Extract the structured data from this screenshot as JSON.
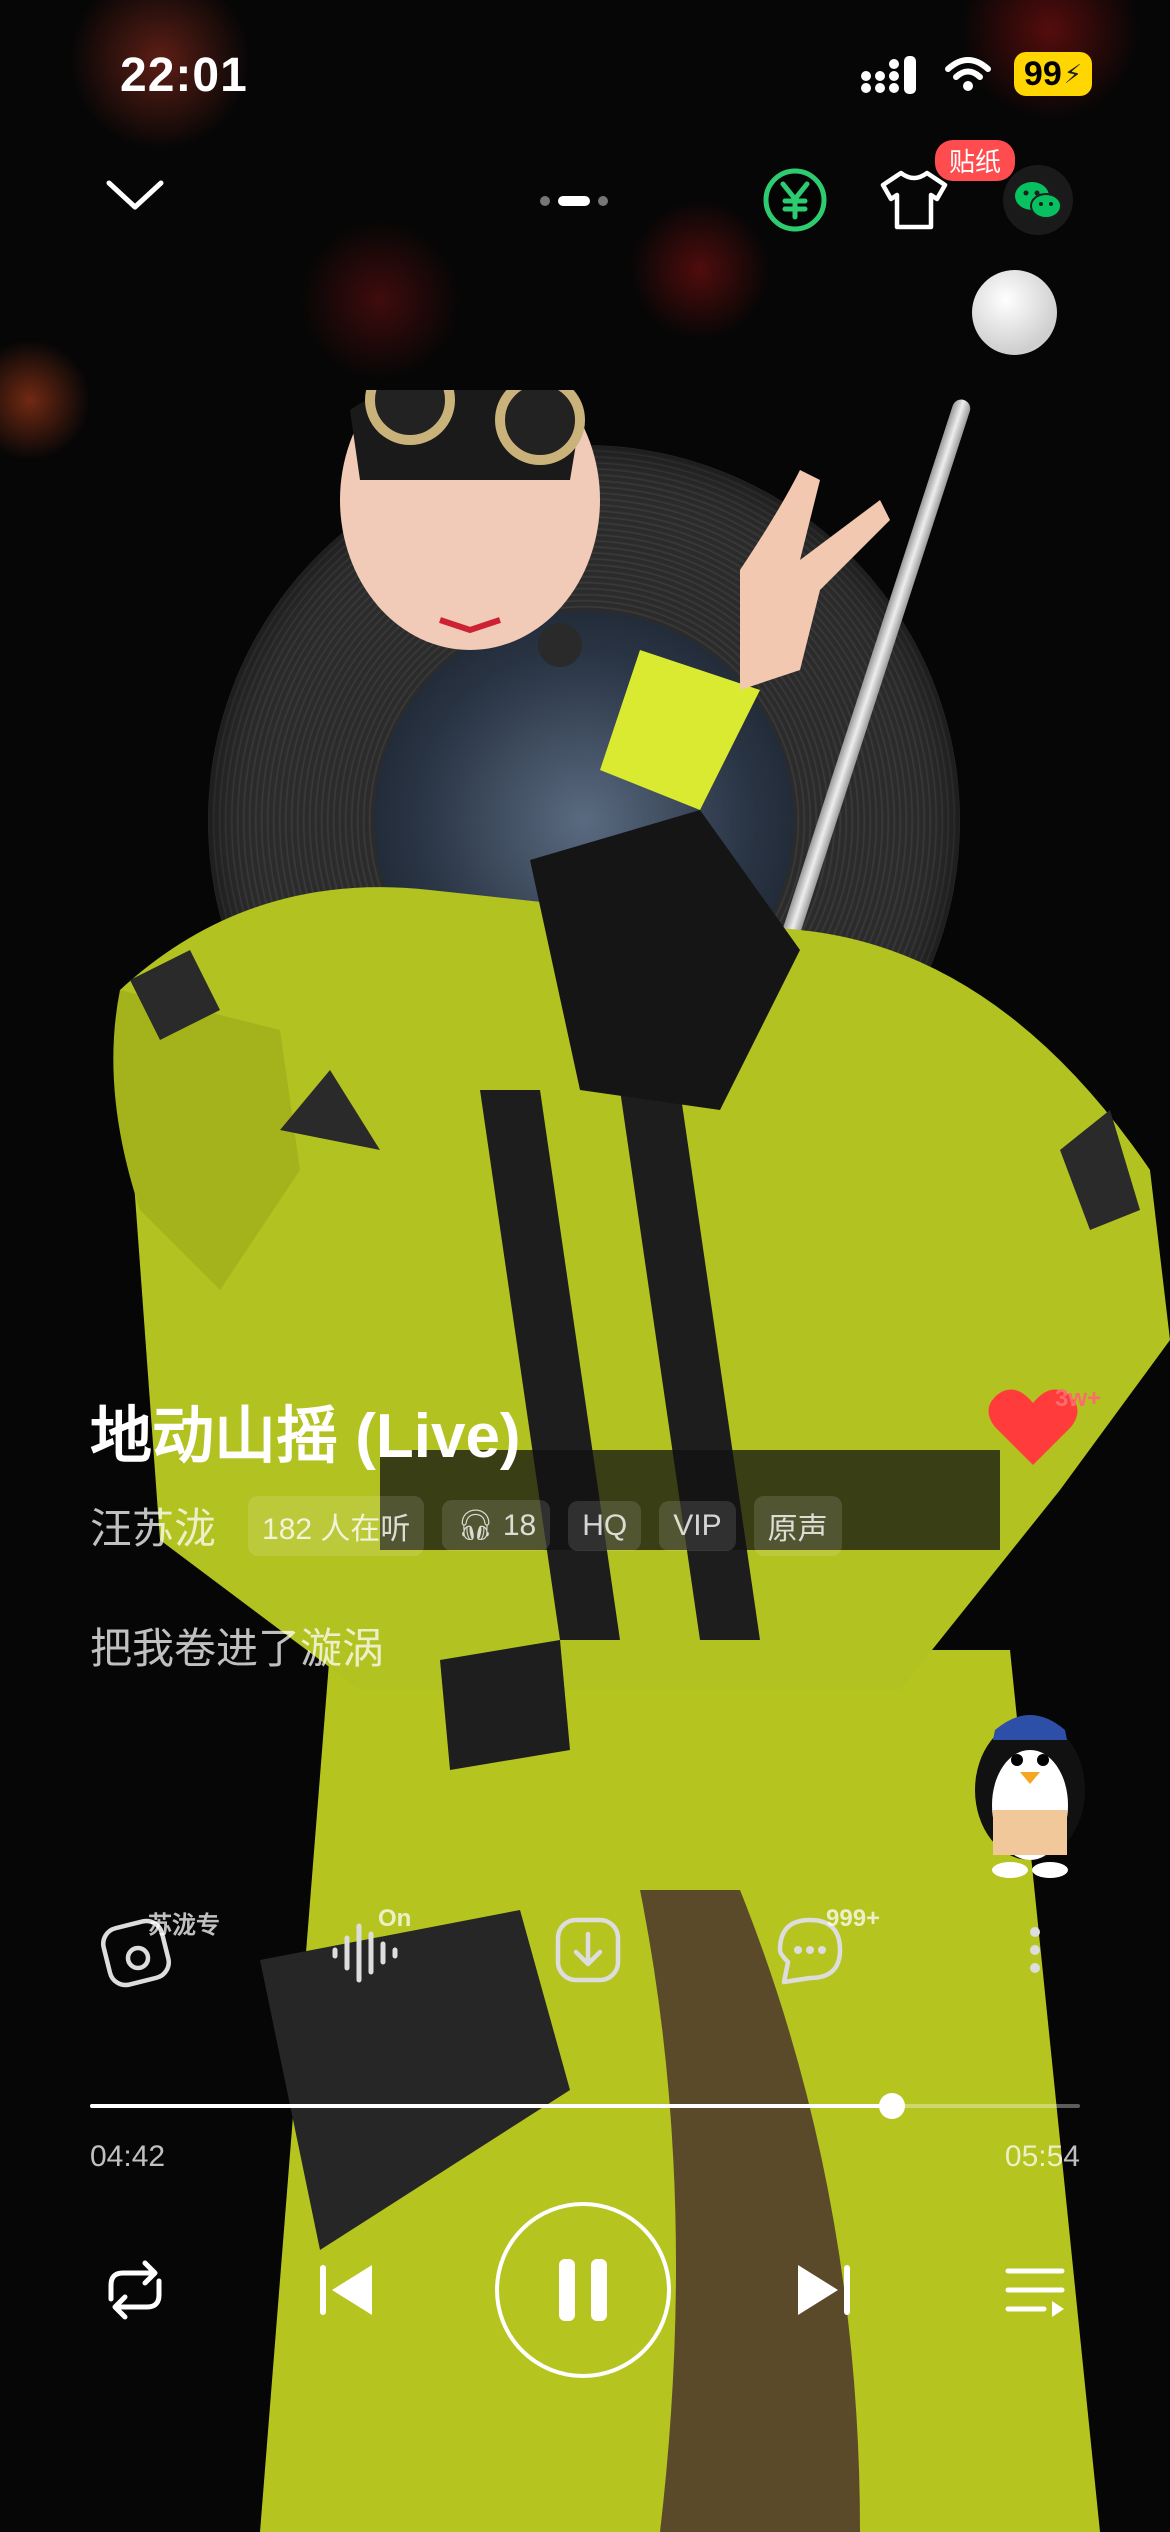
{
  "status_bar": {
    "time": "22:01",
    "battery_level": "99"
  },
  "header": {
    "page_dots": 3,
    "active_dot": 1,
    "sticker_tag": "贴纸"
  },
  "song": {
    "title": "地动山摇 (Live)",
    "artist": "汪苏泷",
    "listeners": "182 人在听",
    "headphone_count": "18",
    "badges": [
      "HQ",
      "VIP",
      "原声"
    ],
    "lyric": "把我卷进了漩涡",
    "likes": "3w+"
  },
  "actions": {
    "album_label": "苏泷专",
    "effect_label": "On",
    "comments_count": "999+"
  },
  "progress": {
    "current": "04:42",
    "total": "05:54",
    "fraction": 0.81
  },
  "colors": {
    "like": "#ff3b3b",
    "battery": "#ffd600",
    "green_icon": "#2ecc71",
    "wechat": "#07c160"
  }
}
